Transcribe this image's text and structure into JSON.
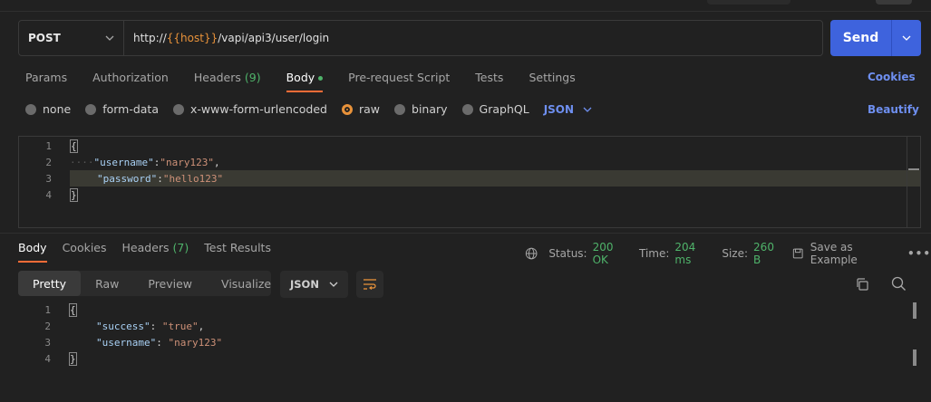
{
  "request": {
    "method": "POST",
    "url_prefix": "http://",
    "url_variable": "{{host}}",
    "url_suffix": "/vapi/api3/user/login",
    "send_label": "Send"
  },
  "request_tabs": [
    {
      "label": "Params"
    },
    {
      "label": "Authorization"
    },
    {
      "label": "Headers",
      "count": "(9)"
    },
    {
      "label": "Body"
    },
    {
      "label": "Pre-request Script"
    },
    {
      "label": "Tests"
    },
    {
      "label": "Settings"
    }
  ],
  "cookies_label": "Cookies",
  "body_types": [
    "none",
    "form-data",
    "x-www-form-urlencoded",
    "raw",
    "binary",
    "GraphQL"
  ],
  "body_format": "JSON",
  "beautify_label": "Beautify",
  "request_body": {
    "line_numbers": [
      "1",
      "2",
      "3",
      "4"
    ],
    "open_brace": "{",
    "close_brace": "}",
    "indent_dots": "····",
    "line2_key": "\"username\"",
    "line2_value": "\"nary123\"",
    "line3_key": "\"password\"",
    "line3_value": "\"hello123\"",
    "colon": ":",
    "comma": ","
  },
  "response_tabs": [
    {
      "label": "Body"
    },
    {
      "label": "Cookies"
    },
    {
      "label": "Headers",
      "count": "(7)"
    },
    {
      "label": "Test Results"
    }
  ],
  "response_status": {
    "status_label": "Status:",
    "status_value": "200 OK",
    "time_label": "Time:",
    "time_value": "204 ms",
    "size_label": "Size:",
    "size_value": "260 B",
    "save_label": "Save as Example"
  },
  "view_modes": [
    "Pretty",
    "Raw",
    "Preview",
    "Visualize"
  ],
  "response_format": "JSON",
  "response_body": {
    "line_numbers": [
      "1",
      "2",
      "3",
      "4"
    ],
    "open_brace": "{",
    "close_brace": "}",
    "line2_key": "\"success\"",
    "line2_value": "\"true\"",
    "line3_key": "\"username\"",
    "line3_value": "\"nary123\"",
    "colon_space": ": ",
    "comma": ","
  },
  "colors": {
    "accent": "#ff6c37",
    "send": "#3e63dd",
    "link": "#6e8ff0",
    "success": "#4fb36a",
    "variable": "#e8923a"
  }
}
